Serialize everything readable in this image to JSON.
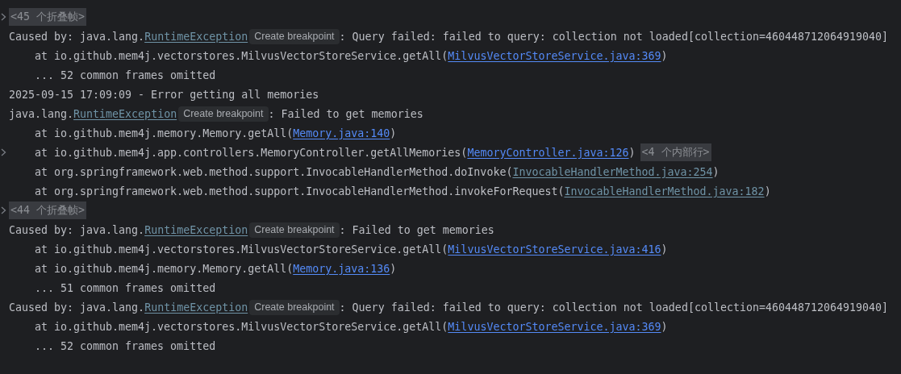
{
  "console_lines": [
    {
      "kind": "fold",
      "expandable": true,
      "indented": false,
      "parts": [
        {
          "kind": "fold",
          "text": "<45 个折叠帧>"
        }
      ]
    },
    {
      "kind": "trace",
      "expandable": false,
      "indented": false,
      "parts": [
        {
          "kind": "text",
          "text": "Caused by: java.lang."
        },
        {
          "kind": "class",
          "text": "RuntimeException"
        },
        {
          "kind": "hint",
          "text": "Create breakpoint"
        },
        {
          "kind": "text",
          "text": ": Query failed: failed to query: collection not loaded[collection=460448712064919040]"
        }
      ]
    },
    {
      "kind": "trace",
      "expandable": false,
      "indented": true,
      "parts": [
        {
          "kind": "text",
          "text": "at io.github.mem4j.vectorstores.MilvusVectorStoreService.getAll("
        },
        {
          "kind": "link",
          "library": false,
          "text": "MilvusVectorStoreService.java:369"
        },
        {
          "kind": "text",
          "text": ")"
        }
      ]
    },
    {
      "kind": "trace",
      "expandable": false,
      "indented": true,
      "parts": [
        {
          "kind": "text",
          "text": "... 52 common frames omitted"
        }
      ]
    },
    {
      "kind": "trace",
      "expandable": false,
      "indented": false,
      "parts": [
        {
          "kind": "text",
          "text": "2025-09-15 17:09:09 - Error getting all memories"
        }
      ]
    },
    {
      "kind": "trace",
      "expandable": false,
      "indented": false,
      "parts": [
        {
          "kind": "text",
          "text": "java.lang."
        },
        {
          "kind": "class",
          "text": "RuntimeException"
        },
        {
          "kind": "hint",
          "text": "Create breakpoint"
        },
        {
          "kind": "text",
          "text": ": Failed to get memories"
        }
      ]
    },
    {
      "kind": "trace",
      "expandable": false,
      "indented": true,
      "parts": [
        {
          "kind": "text",
          "text": "at io.github.mem4j.memory.Memory.getAll("
        },
        {
          "kind": "link",
          "library": false,
          "text": "Memory.java:140"
        },
        {
          "kind": "text",
          "text": ")"
        }
      ]
    },
    {
      "kind": "trace",
      "expandable": true,
      "indented": true,
      "parts": [
        {
          "kind": "text",
          "text": "at io.github.mem4j.app.controllers.MemoryController.getAllMemories("
        },
        {
          "kind": "link",
          "library": false,
          "text": "MemoryController.java:126"
        },
        {
          "kind": "text",
          "text": ")"
        },
        {
          "kind": "fold",
          "text": "<4 个内部行>"
        }
      ]
    },
    {
      "kind": "trace",
      "expandable": false,
      "indented": true,
      "parts": [
        {
          "kind": "text",
          "text": "at org.springframework.web.method.support.InvocableHandlerMethod.doInvoke("
        },
        {
          "kind": "link",
          "library": true,
          "text": "InvocableHandlerMethod.java:254"
        },
        {
          "kind": "text",
          "text": ")"
        }
      ]
    },
    {
      "kind": "trace",
      "expandable": false,
      "indented": true,
      "parts": [
        {
          "kind": "text",
          "text": "at org.springframework.web.method.support.InvocableHandlerMethod.invokeForRequest("
        },
        {
          "kind": "link",
          "library": true,
          "text": "InvocableHandlerMethod.java:182"
        },
        {
          "kind": "text",
          "text": ")"
        }
      ]
    },
    {
      "kind": "fold",
      "expandable": true,
      "indented": false,
      "parts": [
        {
          "kind": "fold",
          "text": "<44 个折叠帧>"
        }
      ]
    },
    {
      "kind": "trace",
      "expandable": false,
      "indented": false,
      "parts": [
        {
          "kind": "text",
          "text": "Caused by: java.lang."
        },
        {
          "kind": "class",
          "text": "RuntimeException"
        },
        {
          "kind": "hint",
          "text": "Create breakpoint"
        },
        {
          "kind": "text",
          "text": ": Failed to get memories"
        }
      ]
    },
    {
      "kind": "trace",
      "expandable": false,
      "indented": true,
      "parts": [
        {
          "kind": "text",
          "text": "at io.github.mem4j.vectorstores.MilvusVectorStoreService.getAll("
        },
        {
          "kind": "link",
          "library": false,
          "text": "MilvusVectorStoreService.java:416"
        },
        {
          "kind": "text",
          "text": ")"
        }
      ]
    },
    {
      "kind": "trace",
      "expandable": false,
      "indented": true,
      "parts": [
        {
          "kind": "text",
          "text": "at io.github.mem4j.memory.Memory.getAll("
        },
        {
          "kind": "link",
          "library": false,
          "text": "Memory.java:136"
        },
        {
          "kind": "text",
          "text": ")"
        }
      ]
    },
    {
      "kind": "trace",
      "expandable": false,
      "indented": true,
      "parts": [
        {
          "kind": "text",
          "text": "... 51 common frames omitted"
        }
      ]
    },
    {
      "kind": "trace",
      "expandable": false,
      "indented": false,
      "parts": [
        {
          "kind": "text",
          "text": "Caused by: java.lang."
        },
        {
          "kind": "class",
          "text": "RuntimeException"
        },
        {
          "kind": "hint",
          "text": "Create breakpoint"
        },
        {
          "kind": "text",
          "text": ": Query failed: failed to query: collection not loaded[collection=460448712064919040]"
        }
      ]
    },
    {
      "kind": "trace",
      "expandable": false,
      "indented": true,
      "parts": [
        {
          "kind": "text",
          "text": "at io.github.mem4j.vectorstores.MilvusVectorStoreService.getAll("
        },
        {
          "kind": "link",
          "library": false,
          "text": "MilvusVectorStoreService.java:369"
        },
        {
          "kind": "text",
          "text": ")"
        }
      ]
    },
    {
      "kind": "trace",
      "expandable": false,
      "indented": true,
      "parts": [
        {
          "kind": "text",
          "text": "... 52 common frames omitted"
        }
      ]
    }
  ]
}
